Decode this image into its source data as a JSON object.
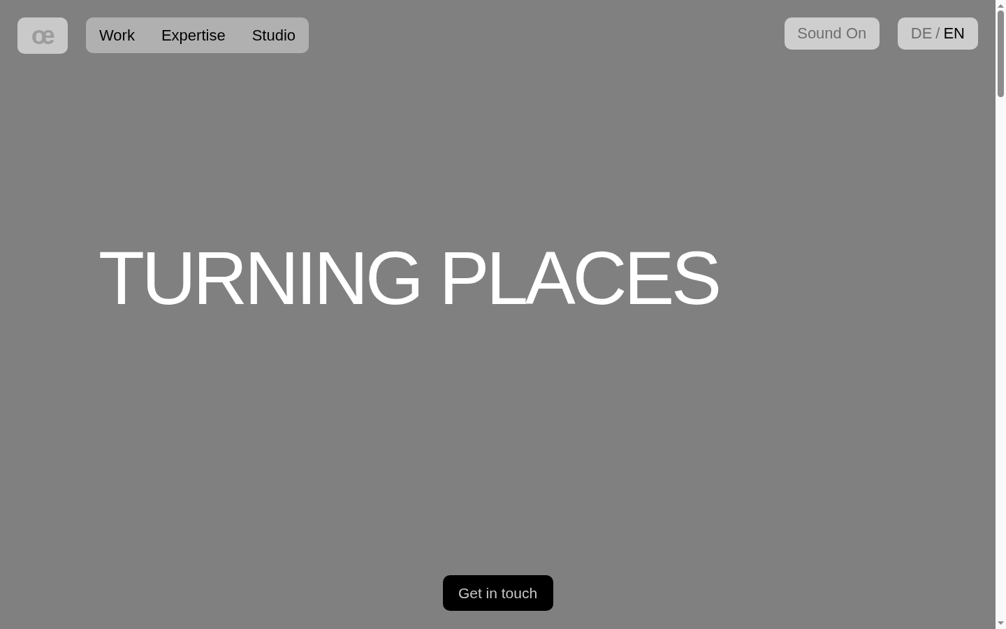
{
  "logo": {
    "text": "œ"
  },
  "nav": {
    "items": [
      {
        "label": "Work"
      },
      {
        "label": "Expertise"
      },
      {
        "label": "Studio"
      }
    ]
  },
  "sound_toggle": {
    "label": "Sound On"
  },
  "language_switcher": {
    "separator": "/",
    "languages": [
      {
        "label": "DE",
        "selected": false
      },
      {
        "label": "EN",
        "selected": true
      }
    ]
  },
  "hero": {
    "title": "TURNING PLACES"
  },
  "cta": {
    "label": "Get in touch"
  }
}
